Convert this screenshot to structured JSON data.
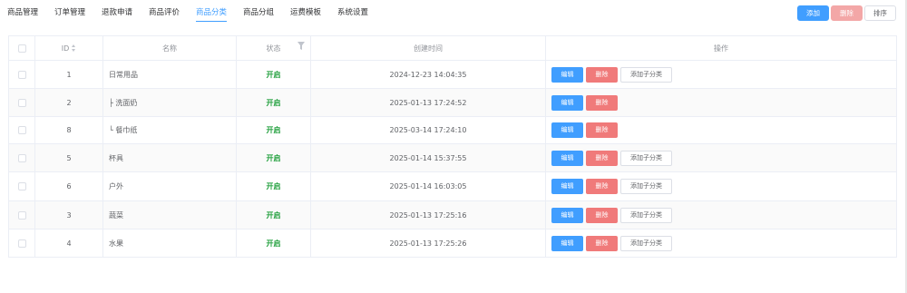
{
  "nav": {
    "tabs": [
      {
        "label": "商品管理",
        "active": false
      },
      {
        "label": "订单管理",
        "active": false
      },
      {
        "label": "退款申请",
        "active": false
      },
      {
        "label": "商品评价",
        "active": false
      },
      {
        "label": "商品分类",
        "active": true
      },
      {
        "label": "商品分组",
        "active": false
      },
      {
        "label": "运费模板",
        "active": false
      },
      {
        "label": "系统设置",
        "active": false
      }
    ]
  },
  "toolbar": {
    "add_label": "添加",
    "delete_label": "删除",
    "sort_label": "排序"
  },
  "table": {
    "columns": {
      "id": "ID",
      "name": "名称",
      "status": "状态",
      "created": "创建时间",
      "actions": "操作"
    },
    "rows": [
      {
        "id": "1",
        "name": "日常用品",
        "status": "开启",
        "created": "2024-12-23 14:04:35",
        "edit": "编辑",
        "delete": "删除",
        "add_child": "添加子分类"
      },
      {
        "id": "2",
        "name": "├ 洗面奶",
        "status": "开启",
        "created": "2025-01-13 17:24:52",
        "edit": "编辑",
        "delete": "删除",
        "add_child": null
      },
      {
        "id": "8",
        "name": "└ 餐巾纸",
        "status": "开启",
        "created": "2025-03-14 17:24:10",
        "edit": "编辑",
        "delete": "删除",
        "add_child": null
      },
      {
        "id": "5",
        "name": "杯具",
        "status": "开启",
        "created": "2025-01-14 15:37:55",
        "edit": "编辑",
        "delete": "删除",
        "add_child": "添加子分类"
      },
      {
        "id": "6",
        "name": "户外",
        "status": "开启",
        "created": "2025-01-14 16:03:05",
        "edit": "编辑",
        "delete": "删除",
        "add_child": "添加子分类"
      },
      {
        "id": "3",
        "name": "蔬菜",
        "status": "开启",
        "created": "2025-01-13 17:25:16",
        "edit": "编辑",
        "delete": "删除",
        "add_child": "添加子分类"
      },
      {
        "id": "4",
        "name": "水果",
        "status": "开启",
        "created": "2025-01-13 17:25:26",
        "edit": "编辑",
        "delete": "删除",
        "add_child": "添加子分类"
      }
    ]
  },
  "colors": {
    "primary": "#409eff",
    "danger": "#f07a7a",
    "status_on": "#1e9e3a"
  }
}
